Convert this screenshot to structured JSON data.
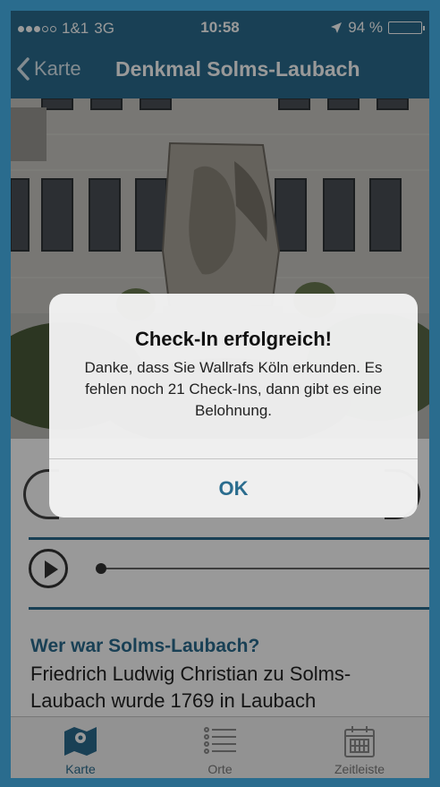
{
  "status_bar": {
    "carrier": "1&1",
    "network": "3G",
    "time": "10:58",
    "battery_text": "94 %",
    "battery_level": 0.94,
    "signal_bars": 3
  },
  "nav": {
    "back_label": "Karte",
    "title": "Denkmal Solms-Laubach"
  },
  "section": {
    "heading": "Wer war Solms-Laubach?",
    "body": "Friedrich Ludwig Christian zu Solms-Laubach wurde 1769 in Laubach (Oberhessen) geboren. Seine Familie"
  },
  "tabs": [
    {
      "label": "Karte",
      "icon": "map-icon",
      "active": true
    },
    {
      "label": "Orte",
      "icon": "list-icon",
      "active": false
    },
    {
      "label": "Zeitleiste",
      "icon": "calendar-icon",
      "active": false
    }
  ],
  "alert": {
    "title": "Check-In erfolgreich!",
    "message": "Danke, dass Sie Wallrafs Köln erkunden. Es fehlen noch 21 Check-Ins, dann gibt es eine Belohnung.",
    "ok_label": "OK"
  },
  "colors": {
    "accent": "#2a6c8e"
  }
}
